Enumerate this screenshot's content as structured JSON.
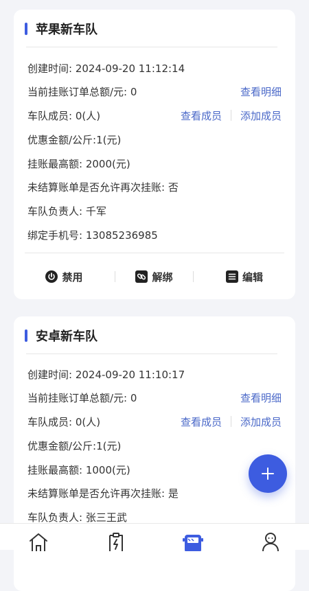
{
  "colors": {
    "accent": "#3d5ce0",
    "link": "#4a68c8",
    "text": "#333333",
    "background": "#f3f4f8"
  },
  "cards": [
    {
      "title": "苹果新车队",
      "created": "创建时间: 2024-09-20 11:12:14",
      "total": "当前挂账订单总额/元: 0",
      "view_detail": "查看明细",
      "members": "车队成员: 0(人)",
      "view_members": "查看成员",
      "add_member": "添加成员",
      "discount": "优惠金额/公斤:1(元)",
      "max_credit": "挂账最高额: 2000(元)",
      "allow_again": "未结算账单是否允许再次挂账: 否",
      "manager": "车队负责人: 千军",
      "phone": "绑定手机号: 13085236985",
      "actions": {
        "disable": "禁用",
        "unbind": "解绑",
        "edit": "编辑"
      }
    },
    {
      "title": "安卓新车队",
      "created": "创建时间: 2024-09-20 11:10:17",
      "total": "当前挂账订单总额/元: 0",
      "view_detail": "查看明细",
      "members": "车队成员: 0(人)",
      "view_members": "查看成员",
      "add_member": "添加成员",
      "discount": "优惠金额/公斤:1(元)",
      "max_credit": "挂账最高额: 1000(元)",
      "allow_again": "未结算账单是否允许再次挂账: 是",
      "manager": "车队负责人: 张三王武"
    }
  ],
  "fab_icon": "plus-icon",
  "tabs": [
    {
      "icon": "home-icon"
    },
    {
      "icon": "charge-clipboard-icon"
    },
    {
      "icon": "fleet-bus-icon",
      "active": true
    },
    {
      "icon": "user-profile-icon"
    }
  ]
}
